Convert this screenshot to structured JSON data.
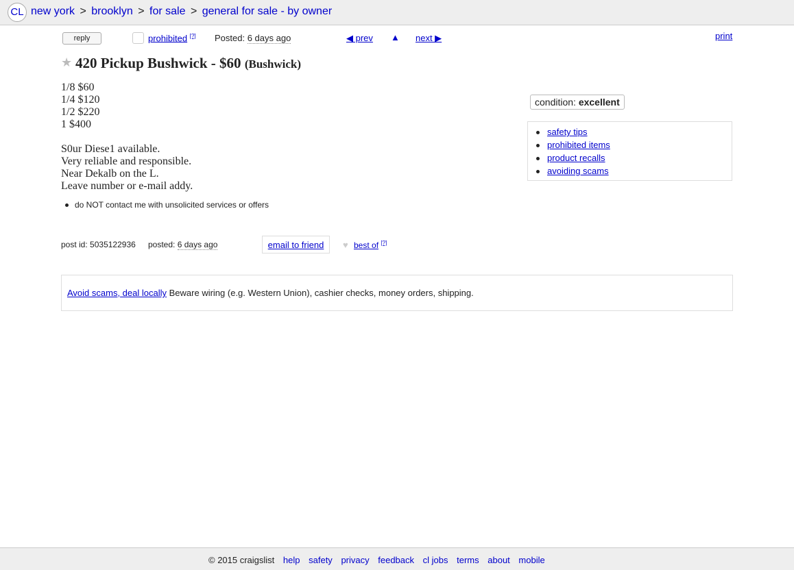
{
  "header": {
    "logo": "CL",
    "breadcrumbs": [
      "new york",
      "brooklyn",
      "for sale",
      "general for sale - by owner"
    ],
    "separator": ">"
  },
  "toolbar": {
    "reply": "reply",
    "prohibited": "prohibited",
    "help_marker": "[?]",
    "posted_label": "Posted:",
    "posted_value": "6 days ago",
    "prev": "◀ prev",
    "up": "▲",
    "next": "next ▶",
    "print": "print"
  },
  "posting": {
    "title": "420 Pickup Bushwick - $60",
    "location": "(Bushwick)",
    "body_lines": [
      "1/8 $60",
      "1/4 $120",
      "1/2 $220",
      "1 $400"
    ],
    "body_lines2": [
      "S0ur Diese1 available.",
      "Very reliable and responsible.",
      "Near Dekalb on the L.",
      "Leave number or e-mail addy."
    ],
    "notice": "do NOT contact me with unsolicited services or offers"
  },
  "attributes": {
    "condition_label": "condition:",
    "condition_value": "excellent"
  },
  "safety_links": [
    "safety tips",
    "prohibited items",
    "product recalls",
    "avoiding scams"
  ],
  "post_info": {
    "post_id_label": "post id:",
    "post_id": "5035122936",
    "posted_label": "posted:",
    "posted_value": "6 days ago",
    "email": "email to friend",
    "best_of": "best of",
    "help_marker": "[?]"
  },
  "scam_warning": {
    "link": "Avoid scams, deal locally",
    "text": "Beware wiring (e.g. Western Union), cashier checks, money orders, shipping."
  },
  "footer": {
    "copyright": "© 2015 craigslist",
    "links": [
      "help",
      "safety",
      "privacy",
      "feedback",
      "cl jobs",
      "terms",
      "about",
      "mobile"
    ]
  },
  "colors": {
    "link": "#0000cc",
    "bar": "#eeeeee",
    "border": "#dddddd"
  },
  "icons": {
    "star": "star-icon",
    "heart": "heart-icon",
    "bullet": "bullet-icon"
  }
}
